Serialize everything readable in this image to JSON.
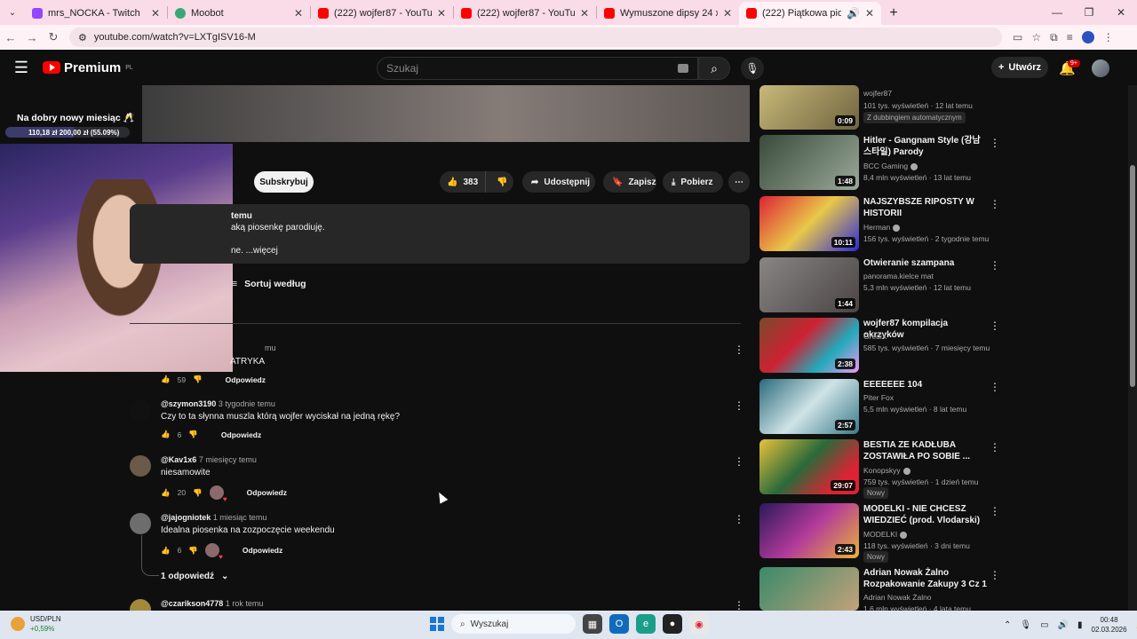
{
  "browser": {
    "tabs": [
      {
        "title": "mrs_NOCKA - Twitch",
        "favicon_color": "#9146ff"
      },
      {
        "title": "Moobot",
        "favicon_color": "#3aa876"
      },
      {
        "title": "(222) wojfer87 - YouTube",
        "favicon_color": "#ff0000"
      },
      {
        "title": "(222) wojfer87 - YouTube",
        "favicon_color": "#ff0000"
      },
      {
        "title": "Wymuszone dipsy 24 x 95 kg -",
        "favicon_color": "#ff0000"
      },
      {
        "title": "(222) Piątkowa piosenka - V",
        "favicon_color": "#ff0000"
      }
    ],
    "url": "youtube.com/watch?v=LXTgISV16-M"
  },
  "yt_header": {
    "logo": "Premium",
    "region": "PL",
    "search_placeholder": "Szukaj",
    "create_label": "Utwórz",
    "notif_badge": "9+"
  },
  "stream_overlay": {
    "goal_title": "Na dobry nowy miesiąc 🥂",
    "goal_text": "110,18 zł   200,00 zł (55.09%)",
    "goal_fraction": 0.5509
  },
  "actions": {
    "subscribe": "Subskrybuj",
    "likes": "383",
    "share": "Udostępnij",
    "save": "Zapisz",
    "download": "Pobierz"
  },
  "description": {
    "line1": "temu",
    "line2": "aką piosenkę parodiuję.",
    "line3": "ne. ...więcej"
  },
  "comments_section": {
    "sort_label": "Sortuj według",
    "reply_label": "Odpowiedz",
    "replies_link": "1 odpowiedź"
  },
  "comments": [
    {
      "author": "",
      "time": "mu",
      "text": "ATRYKA",
      "likes": "59",
      "heart": false
    },
    {
      "author": "@szymon3190",
      "time": "3 tygodnie temu",
      "text": "Czy to ta słynna muszla którą wojfer wyciskał na jedną rękę?",
      "likes": "6",
      "heart": false
    },
    {
      "author": "@Kav1x6",
      "time": "7 miesięcy temu",
      "text": "niesamowite",
      "likes": "20",
      "heart": true
    },
    {
      "author": "@jajogniotek",
      "time": "1 miesiąc temu",
      "text": "Idealna piosenka na zozpoczęcie weekendu",
      "likes": "6",
      "heart": true
    },
    {
      "author": "@czarikson4778",
      "time": "1 rok temu",
      "text": "",
      "likes": "",
      "heart": false
    }
  ],
  "recommendations": [
    {
      "title": "",
      "channel": "wojfer87",
      "meta": "101 tys. wyświetleń · 12 lat temu",
      "duration": "0:09",
      "badge": "Z dubbingiem automatycznym"
    },
    {
      "title": "Hitler - Gangnam Style (강남스타일) Parody",
      "channel": "BCC Gaming",
      "meta": "8,4 mln wyświetleń · 13 lat temu",
      "duration": "1:48",
      "badge": ""
    },
    {
      "title": "NAJSZYBSZE RIPOSTY W HISTORII",
      "channel": "Herman",
      "meta": "156 tys. wyświetleń · 2 tygodnie temu",
      "duration": "10:11",
      "badge": ""
    },
    {
      "title": "Otwieranie szampana",
      "channel": "panorama.kielce mat",
      "meta": "5,3 mln wyświetleń · 12 lat temu",
      "duration": "1:44",
      "badge": ""
    },
    {
      "title": "wojfer87 kompilacja okrzyków",
      "channel": "GrediX",
      "meta": "585 tys. wyświetleń · 7 miesięcy temu",
      "duration": "2:38",
      "badge": ""
    },
    {
      "title": "EEEEEEE 104",
      "channel": "Piter Fox",
      "meta": "5,5 mln wyświetleń · 8 lat temu",
      "duration": "2:57",
      "badge": ""
    },
    {
      "title": "BESTIA ZE KADŁUBA ZOSTAWIŁA PO SOBIE ...",
      "channel": "Konopskyy",
      "meta": "759 tys. wyświetleń · 1 dzień temu",
      "duration": "29:07",
      "badge": "Nowy"
    },
    {
      "title": "MODELKI - NIE CHCESZ WIEDZIEĆ (prod. Vlodarski)",
      "channel": "MODELKI",
      "meta": "118 tys. wyświetleń · 3 dni temu",
      "duration": "2:43",
      "badge": "Nowy"
    },
    {
      "title": "Adrian Nowak Żalno Rozpakowanie Zakupy 3 Cz 1",
      "channel": "Adrian Nowak Żalno",
      "meta": "1,6 mln wyświetleń · 4 lata temu",
      "duration": "",
      "badge": ""
    }
  ],
  "taskbar": {
    "widget_title": "USD/PLN",
    "widget_change": "+0,59%",
    "widget_badge": "2",
    "search_label": "Wyszukaj",
    "time": "00:48",
    "date": "02.03.2026"
  }
}
